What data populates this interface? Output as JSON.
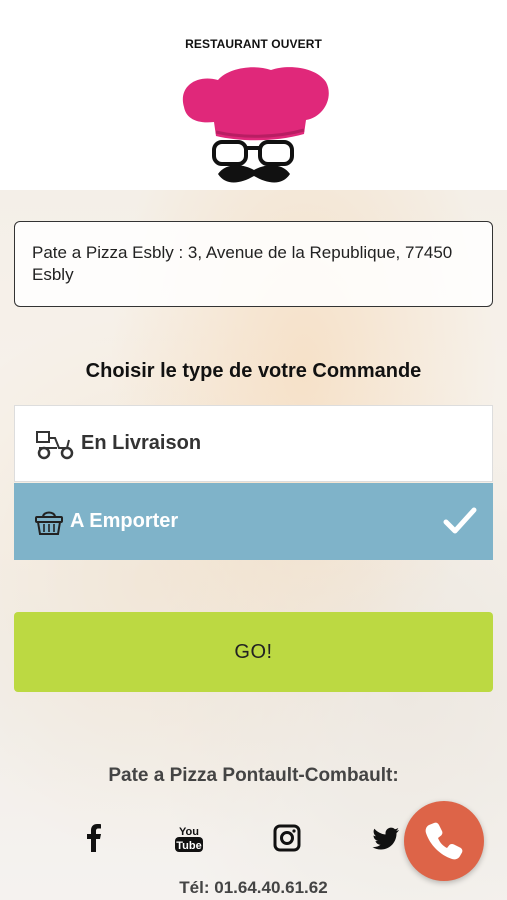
{
  "status": "RESTAURANT OUVERT",
  "address": "Pate a Pizza Esbly : 3, Avenue de la Republique, 77450 Esbly",
  "order_section": {
    "title": "Choisir le type de votre Commande",
    "options": [
      {
        "label": "En Livraison",
        "icon": "scooter-icon",
        "selected": false
      },
      {
        "label": "A Emporter",
        "icon": "basket-icon",
        "selected": true
      }
    ]
  },
  "go_button": "GO!",
  "footer": {
    "store_name": "Pate a Pizza Pontault-Combault:",
    "social": [
      "facebook-icon",
      "youtube-icon",
      "instagram-icon",
      "twitter-icon"
    ],
    "phone": "Tél: 01.64.40.61.62"
  },
  "colors": {
    "selected_option": "#7fb3c9",
    "go_button": "#bcd942",
    "call_button": "#dd6448",
    "logo_hat": "#e0287a"
  }
}
